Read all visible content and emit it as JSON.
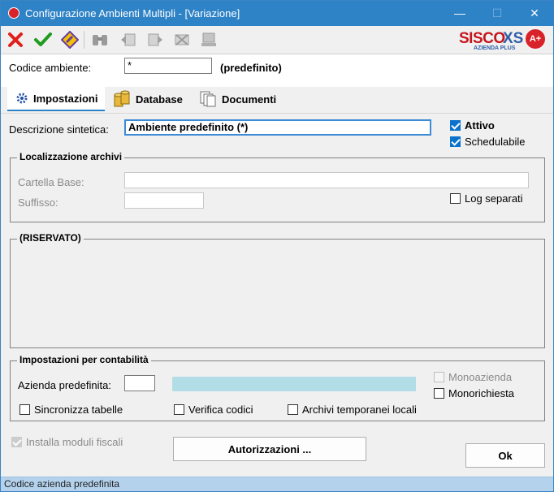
{
  "window": {
    "title": "Configurazione Ambienti Multipli - [Variazione]",
    "minimize_label": "—",
    "maximize_label": "☐",
    "close_label": "✕"
  },
  "toolbar": {
    "icons": [
      "cancel-icon",
      "confirm-icon",
      "edit-icon",
      "search-icon",
      "prev-record-icon",
      "next-record-icon",
      "delete-icon",
      "print-icon"
    ],
    "logo_text": "SISCO",
    "logo_accent": "XS",
    "logo_subtitle": "AZIENDA PLUS",
    "logo_badge": "A+"
  },
  "header": {
    "codice_label": "Codice ambiente:",
    "codice_value": "*",
    "codice_note": "(predefinito)"
  },
  "tabs": [
    {
      "label": "Impostazioni",
      "icon": "gear-icon",
      "active": true
    },
    {
      "label": "Database",
      "icon": "database-icon",
      "active": false
    },
    {
      "label": "Documenti",
      "icon": "documents-icon",
      "active": false
    }
  ],
  "impostazioni": {
    "descrizione_label": "Descrizione sintetica:",
    "descrizione_value": "Ambiente predefinito (*)",
    "attivo_label": "Attivo",
    "schedulabile_label": "Schedulabile",
    "localizzazione": {
      "legend": "Localizzazione archivi",
      "cartella_label": "Cartella Base:",
      "cartella_value": "",
      "suffisso_label": "Suffisso:",
      "suffisso_value": "",
      "log_label": "Log separati"
    },
    "riservato_legend": "(RISERVATO)",
    "contabilita": {
      "legend": "Impostazioni per contabilità",
      "azienda_label": "Azienda predefinita:",
      "azienda_value": "",
      "monoazienda_label": "Monoazienda",
      "monorichiesta_label": "Monorichiesta",
      "sincronizza_label": "Sincronizza tabelle",
      "verifica_label": "Verifica codici",
      "archivi_label": "Archivi temporanei locali"
    },
    "installa_label": "Installa moduli fiscali"
  },
  "buttons": {
    "autorizzazioni": "Autorizzazioni ...",
    "ok": "Ok"
  },
  "status": {
    "text": "Codice azienda predefinita"
  },
  "colors": {
    "titlebar": "#2e82c6",
    "azienda_desc_bg": "#b3dde6",
    "focus_border": "#3b8bd6",
    "status_bg": "#b4d2ec"
  }
}
